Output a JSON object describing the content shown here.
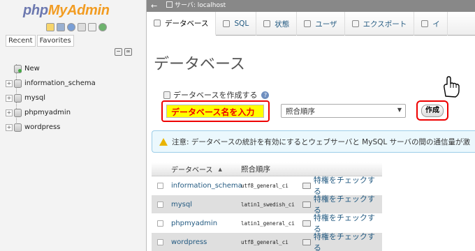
{
  "sidebar": {
    "logo_php": "php",
    "logo_myadmin": "MyAdmin",
    "tabs": [
      {
        "label": "Recent"
      },
      {
        "label": "Favorites"
      }
    ],
    "collapse_icons": [
      "collapse-all-icon",
      "link-icon"
    ],
    "tree": [
      {
        "label": "New",
        "icon": "new-db-icon"
      },
      {
        "label": "information_schema",
        "icon": "database-icon"
      },
      {
        "label": "mysql",
        "icon": "database-icon"
      },
      {
        "label": "phpmyadmin",
        "icon": "database-icon"
      },
      {
        "label": "wordpress",
        "icon": "database-icon"
      }
    ]
  },
  "topbar": {
    "back_glyph": "←",
    "server_label": "サーバ: localhost"
  },
  "menu": {
    "tabs": [
      {
        "label": "データベース",
        "icon": "database-icon",
        "active": true
      },
      {
        "label": "SQL",
        "icon": "sql-icon"
      },
      {
        "label": "状態",
        "icon": "status-icon"
      },
      {
        "label": "ユーザ",
        "icon": "users-icon"
      },
      {
        "label": "エクスポート",
        "icon": "export-icon"
      },
      {
        "label": "イ",
        "icon": "import-icon"
      }
    ]
  },
  "main": {
    "title": "データベース",
    "create_label": "データベースを作成する",
    "help_glyph": "?",
    "dbname_value": "データベース名を入力",
    "collation_value": "照合順序",
    "collation_arrow": "▼",
    "create_button": "作成",
    "notice": "注意: データベースの統計を有効にするとウェブサーバと MySQL サーバの間の通信量が激",
    "table": {
      "headers": {
        "name": "データベース",
        "collation": "照合順序",
        "sort": "▲"
      },
      "rows": [
        {
          "name": "information_schema",
          "collation": "utf8_general_ci",
          "privileges": "特権をチェックする"
        },
        {
          "name": "mysql",
          "collation": "latin1_swedish_ci",
          "privileges": "特権をチェックする"
        },
        {
          "name": "phpmyadmin",
          "collation": "latin1_general_ci",
          "privileges": "特権をチェックする"
        },
        {
          "name": "wordpress",
          "collation": "utf8_general_ci",
          "privileges": "特権をチェックする"
        }
      ]
    }
  },
  "colors": {
    "highlight_border": "#ee0000",
    "input_background": "#ffff00",
    "link": "#235a81",
    "notice_background": "#ebf8fd"
  }
}
